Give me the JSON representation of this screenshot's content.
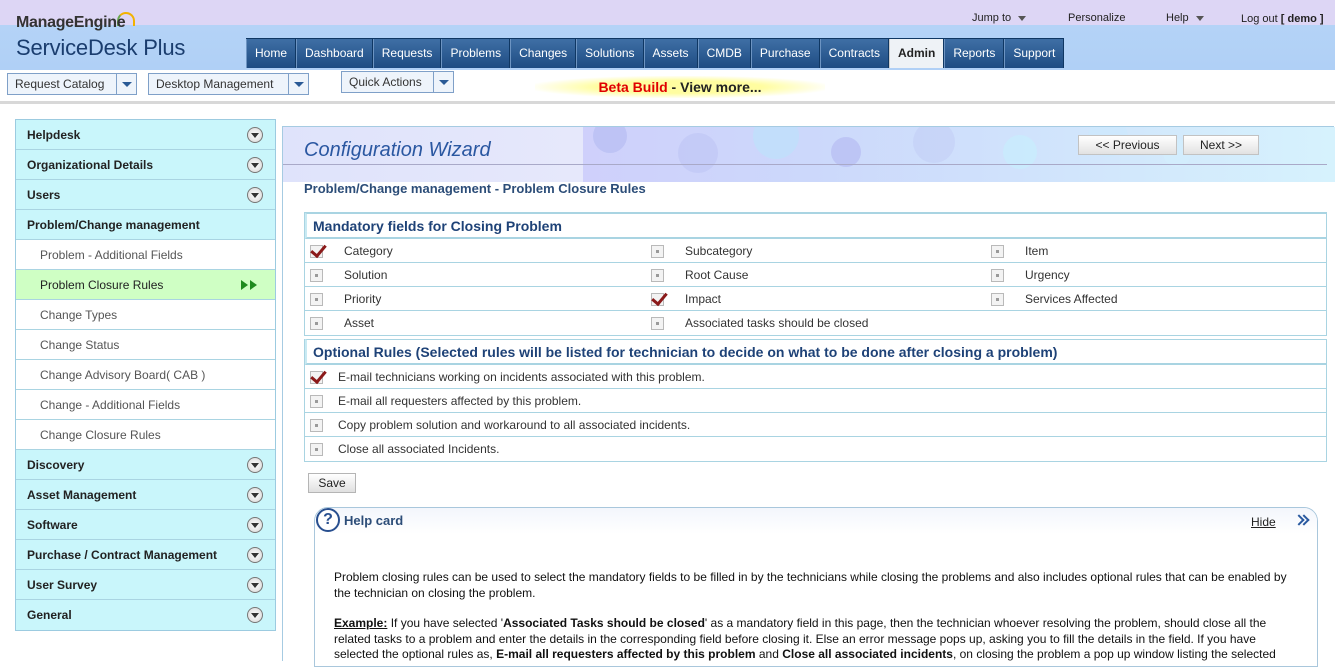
{
  "header": {
    "logo_top": "ManageEngine",
    "logo_bottom": "ServiceDesk Plus",
    "links": {
      "jump_to": "Jump to",
      "personalize": "Personalize",
      "help": "Help",
      "logout": "Log out",
      "user": "[ demo ]"
    },
    "tabs": [
      "Home",
      "Dashboard",
      "Requests",
      "Problems",
      "Changes",
      "Solutions",
      "Assets",
      "CMDB",
      "Purchase",
      "Contracts",
      "Admin",
      "Reports",
      "Support"
    ],
    "active_tab": "Admin"
  },
  "subbar": {
    "request_catalog": "Request Catalog",
    "desktop_management": "Desktop Management",
    "quick_actions": "Quick Actions",
    "beta_red": "Beta Build",
    "beta_rest": " - View more..."
  },
  "sidebar": {
    "items": [
      {
        "label": "Helpdesk",
        "type": "section"
      },
      {
        "label": "Organizational Details",
        "type": "section"
      },
      {
        "label": "Users",
        "type": "section"
      },
      {
        "label": "Problem/Change management",
        "type": "section-open"
      },
      {
        "label": "Problem - Additional Fields",
        "type": "sub"
      },
      {
        "label": "Problem Closure Rules",
        "type": "sub-active"
      },
      {
        "label": "Change Types",
        "type": "sub"
      },
      {
        "label": "Change Status",
        "type": "sub"
      },
      {
        "label": "Change Advisory Board( CAB )",
        "type": "sub"
      },
      {
        "label": "Change - Additional Fields",
        "type": "sub"
      },
      {
        "label": "Change Closure Rules",
        "type": "sub"
      },
      {
        "label": "Discovery",
        "type": "section"
      },
      {
        "label": "Asset Management",
        "type": "section"
      },
      {
        "label": "Software",
        "type": "section"
      },
      {
        "label": "Purchase / Contract Management",
        "type": "section"
      },
      {
        "label": "User Survey",
        "type": "section"
      },
      {
        "label": "General",
        "type": "section"
      }
    ]
  },
  "wizard": {
    "title": "Configuration Wizard",
    "previous": "<< Previous",
    "next": "Next >>",
    "page_title": "Problem/Change management - Problem Closure Rules"
  },
  "mandatory": {
    "heading": "Mandatory fields for Closing Problem",
    "rows": [
      [
        {
          "label": "Category",
          "checked": true
        },
        {
          "label": "Subcategory",
          "checked": false
        },
        {
          "label": "Item",
          "checked": false
        }
      ],
      [
        {
          "label": "Solution",
          "checked": false
        },
        {
          "label": "Root Cause",
          "checked": false
        },
        {
          "label": "Urgency",
          "checked": false
        }
      ],
      [
        {
          "label": "Priority",
          "checked": false
        },
        {
          "label": "Impact",
          "checked": true
        },
        {
          "label": "Services Affected",
          "checked": false
        }
      ],
      [
        {
          "label": "Asset",
          "checked": false
        },
        {
          "label": "Associated tasks should be closed",
          "checked": false
        }
      ]
    ]
  },
  "optional": {
    "heading": "Optional Rules (Selected rules will be listed for technician to decide on what to be done after closing a problem)",
    "rows": [
      {
        "label": "E-mail technicians working on incidents associated with this problem.",
        "checked": true
      },
      {
        "label": "E-mail all requesters affected by this problem.",
        "checked": false
      },
      {
        "label": "Copy problem solution and workaround to all associated incidents.",
        "checked": false
      },
      {
        "label": "Close all associated Incidents.",
        "checked": false
      }
    ]
  },
  "save_label": "Save",
  "help": {
    "icon": "?",
    "title": "Help card",
    "hide": "Hide",
    "para1": "Problem closing rules can be used to select the mandatory fields to be filled in by the technicians while closing the problems and also includes optional rules that can be enabled by the technician on closing the problem.",
    "example_label": "Example:",
    "ex1": " If you have selected '",
    "ex_b1": "Associated Tasks should be closed",
    "ex2": "' as a mandatory field in this page, then the technician whoever resolving the problem, should close all the related tasks to a problem and enter the details in the corresponding field before closing it. Else an error message pops up, asking you to fill the details in the field. If you have selected the optional rules as, ",
    "ex_b2": "E-mail all requesters affected by this problem",
    "ex3": " and ",
    "ex_b3": "Close all associated incidents",
    "ex4": ", on closing the problem a pop up window listing the selected"
  },
  "colors": {
    "nav_tab": "#2a5a92",
    "section_bg": "#c9f6fb",
    "active_item_bg": "#cfffc4",
    "heading_blue": "#1e4277",
    "check_mark": "#8b1a1a"
  }
}
